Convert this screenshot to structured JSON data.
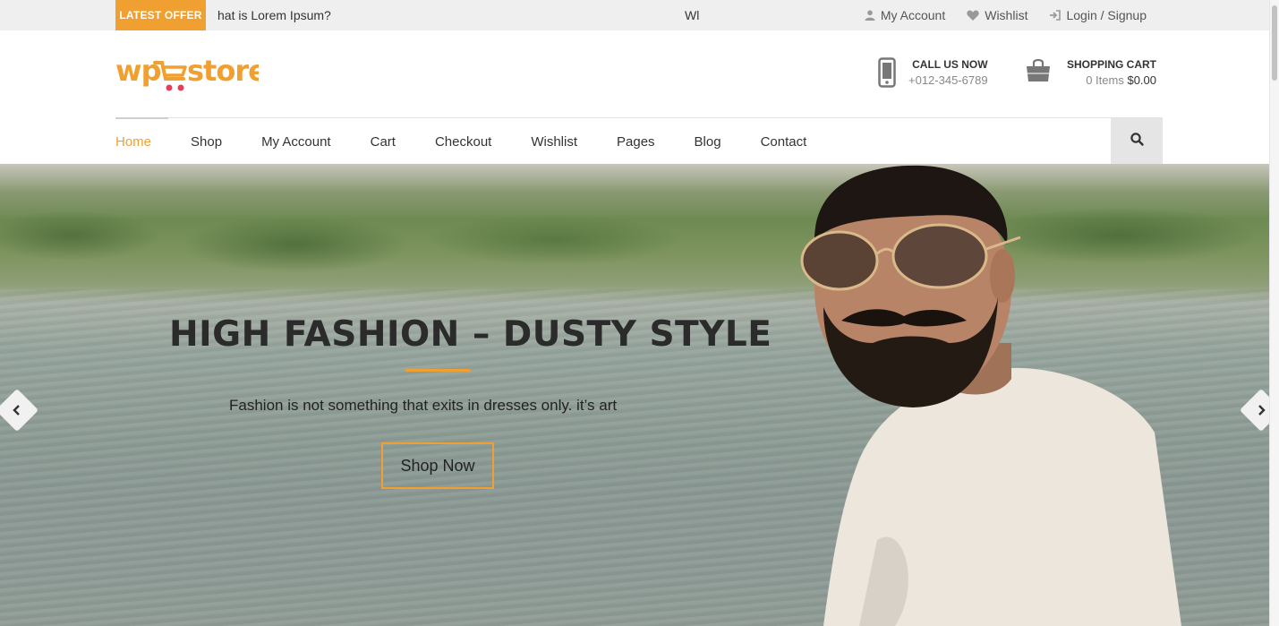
{
  "topbar": {
    "offer_badge": "LATEST OFFER",
    "ticker_text": "hat is Lorem Ipsum?",
    "ticker_text_2": "Wl",
    "links": [
      {
        "label": "My Account",
        "icon": "user-icon"
      },
      {
        "label": "Wishlist",
        "icon": "heart-icon"
      },
      {
        "label": "Login / Signup",
        "icon": "login-icon"
      }
    ]
  },
  "header": {
    "logo": "wpstore",
    "logo_parts": {
      "first": "wp",
      "second": "store"
    },
    "call": {
      "title": "CALL US NOW",
      "phone": "+012-345-6789",
      "icon": "mobile-phone-icon"
    },
    "cart": {
      "title": "SHOPPING CART",
      "items": "0 Items",
      "total": "$0.00",
      "icon": "shopping-bag-icon"
    }
  },
  "nav": {
    "items": [
      "Home",
      "Shop",
      "My Account",
      "Cart",
      "Checkout",
      "Wishlist",
      "Pages",
      "Blog",
      "Contact"
    ],
    "active": "Home",
    "search_icon": "search-icon"
  },
  "hero": {
    "title": "HIGH FASHION – DUSTY STYLE",
    "subtitle": "Fashion is not something that exits in  dresses only. it’s art",
    "cta": "Shop Now",
    "prev_icon": "chevron-left-icon",
    "next_icon": "chevron-right-icon"
  },
  "colors": {
    "accent": "#f0a030",
    "topbar_bg": "#efefef",
    "text": "#333333"
  }
}
